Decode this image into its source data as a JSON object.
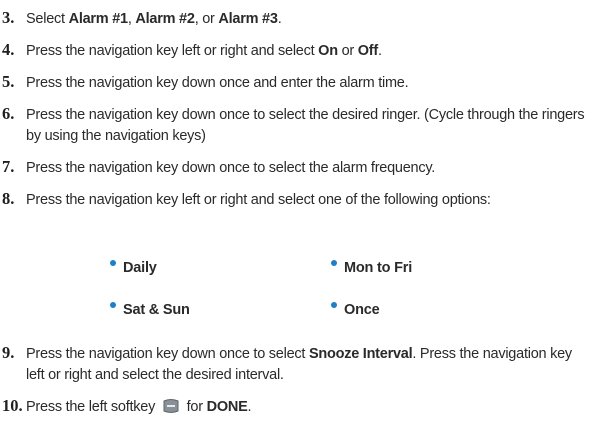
{
  "steps": [
    {
      "num": "3.",
      "parts": [
        {
          "t": "Select "
        },
        {
          "b": "Alarm #1"
        },
        {
          "t": ", "
        },
        {
          "b": "Alarm #2"
        },
        {
          "t": ", or "
        },
        {
          "b": "Alarm #3"
        },
        {
          "t": "."
        }
      ]
    },
    {
      "num": "4.",
      "parts": [
        {
          "t": "Press the navigation key left or right and select "
        },
        {
          "b": "On"
        },
        {
          "t": " or "
        },
        {
          "b": "Off"
        },
        {
          "t": "."
        }
      ]
    },
    {
      "num": "5.",
      "parts": [
        {
          "t": "Press the navigation key down once and enter the alarm time."
        }
      ]
    },
    {
      "num": "6.",
      "parts": [
        {
          "t": "Press the navigation key down once to select the desired ringer. (Cycle through the ringers by using the navigation keys)"
        }
      ]
    },
    {
      "num": "7.",
      "parts": [
        {
          "t": "Press the navigation key down once to select the alarm frequency."
        }
      ]
    },
    {
      "num": "8.",
      "parts": [
        {
          "t": "Press the navigation key left or right and select one of the following options:"
        }
      ]
    },
    {
      "num": "9.",
      "parts": [
        {
          "t": "Press the navigation key down once to select "
        },
        {
          "b": "Snooze Interval"
        },
        {
          "t": ". Press the navigation key left or right and select the desired interval."
        }
      ]
    },
    {
      "num": "10.",
      "parts": [
        {
          "t": "Press the left softkey "
        },
        {
          "icon": "left-softkey-icon"
        },
        {
          "t": " for "
        },
        {
          "b": "DONE"
        },
        {
          "t": "."
        }
      ]
    }
  ],
  "frequency_options": [
    "Daily",
    "Mon to Fri",
    "Sat & Sun",
    "Once"
  ],
  "colors": {
    "bullet": "#1e7fc7",
    "text": "#2a2a2a"
  }
}
